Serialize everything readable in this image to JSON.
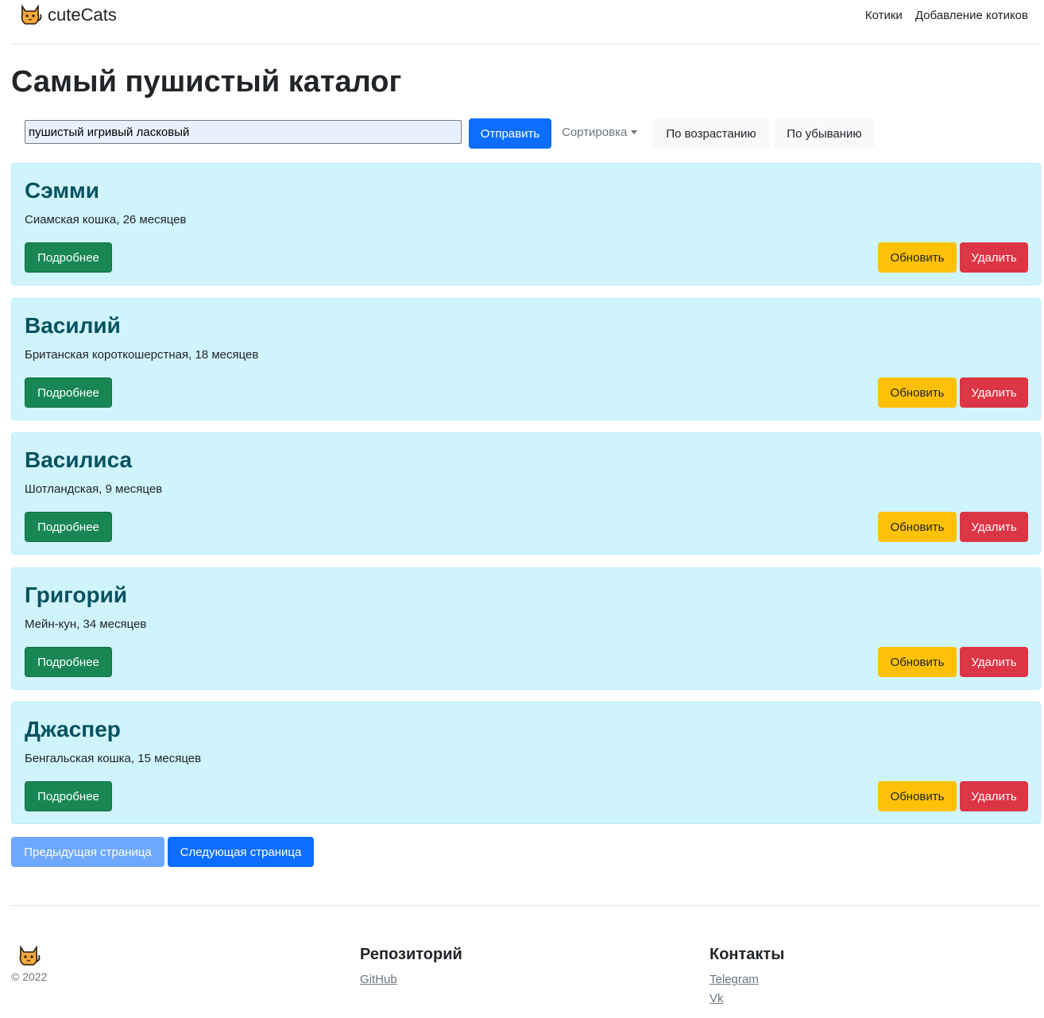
{
  "header": {
    "brand": "cuteCats",
    "nav": [
      "Котики",
      "Добавление котиков"
    ]
  },
  "page_title": "Самый пушистый каталог",
  "search": {
    "value": "пушистый игривый ласковый"
  },
  "toolbar": {
    "submit_label": "Отправить",
    "sort_label": "Сортировка",
    "asc_label": "По возрастанию",
    "desc_label": "По убыванию"
  },
  "cats": [
    {
      "name": "Сэмми",
      "description": "Сиамская кошка, 26 месяцев"
    },
    {
      "name": "Василий",
      "description": "Британская короткошерстная, 18 месяцев"
    },
    {
      "name": "Василиса",
      "description": "Шотландская, 9 месяцев"
    },
    {
      "name": "Григорий",
      "description": "Мейн-кун, 34 месяцев"
    },
    {
      "name": "Джаспер",
      "description": "Бенгальская кошка, 15 месяцев"
    }
  ],
  "card_actions": {
    "more": "Подробнее",
    "update": "Обновить",
    "delete": "Удалить"
  },
  "pagination": {
    "prev": "Предыдущая страница",
    "next": "Следующая страница"
  },
  "footer": {
    "copyright": "© 2022",
    "repo_heading": "Репозиторий",
    "repo_links": [
      "GitHub"
    ],
    "contacts_heading": "Контакты",
    "contact_links": [
      "Telegram",
      "Vk"
    ]
  },
  "colors": {
    "primary": "#0d6efd",
    "success": "#198754",
    "warning": "#ffc107",
    "danger": "#dc3545",
    "card_bg": "#cff4fc",
    "card_title": "#055160"
  },
  "icons": {
    "logo": "cat-logo-icon"
  }
}
